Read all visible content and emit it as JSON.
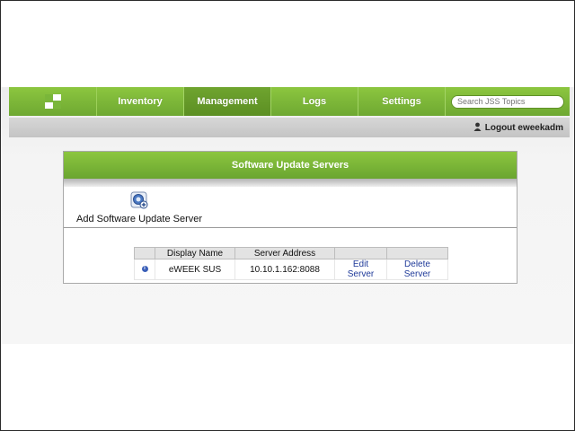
{
  "nav": {
    "logo_icon": "jss-logo-icon",
    "tabs": [
      {
        "label": "Inventory",
        "active": false
      },
      {
        "label": "Management",
        "active": true
      },
      {
        "label": "Logs",
        "active": false
      },
      {
        "label": "Settings",
        "active": false
      }
    ],
    "search_placeholder": "Search JSS Topics"
  },
  "subbar": {
    "logout_label": "Logout eweekadm",
    "logout_icon": "user-icon"
  },
  "panel": {
    "title": "Software Update Servers",
    "add_label": "Add Software Update Server",
    "add_icon": "add-server-icon"
  },
  "table": {
    "columns": [
      "",
      "Display Name",
      "Server Address",
      "",
      ""
    ],
    "rows": [
      {
        "info_icon": "info-icon",
        "display_name": "eWEEK SUS",
        "server_address": "10.10.1.162:8088",
        "edit_label": "Edit Server",
        "delete_label": "Delete Server"
      }
    ]
  },
  "colors": {
    "accent_green": "#7ab63a",
    "link_blue": "#1f3a99"
  }
}
